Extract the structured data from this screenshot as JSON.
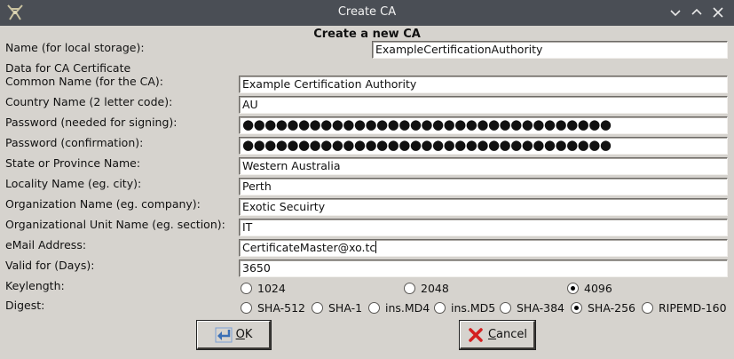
{
  "window": {
    "title": "Create CA"
  },
  "form": {
    "heading": "Create a new CA",
    "name_label": "Name (for local storage):",
    "name_value": "ExampleCertificationAuthority",
    "section_label": "Data for CA Certificate",
    "fields": [
      {
        "label": "Common Name (for the CA):",
        "value": "Example Certification Authority"
      },
      {
        "label": "Country Name (2 letter code):",
        "value": "AU"
      },
      {
        "label": "Password (needed for signing):",
        "value": "●●●●●●●●●●●●●●●●●●●●●●●●●●●●●●●●●"
      },
      {
        "label": "Password (confirmation):",
        "value": "●●●●●●●●●●●●●●●●●●●●●●●●●●●●●●●●●"
      },
      {
        "label": "State or Province Name:",
        "value": "Western Australia"
      },
      {
        "label": "Locality Name (eg. city):",
        "value": "Perth"
      },
      {
        "label": "Organization Name (eg. company):",
        "value": "Exotic Secuirty"
      },
      {
        "label": "Organizational Unit Name (eg. section):",
        "value": "IT"
      },
      {
        "label": "eMail Address:",
        "value": "CertificateMaster@xo.tc"
      },
      {
        "label": "Valid for (Days):",
        "value": "3650"
      }
    ],
    "keylength": {
      "label": "Keylength:",
      "options": [
        "1024",
        "2048",
        "4096"
      ],
      "selected": "4096"
    },
    "digest": {
      "label": "Digest:",
      "options": [
        "SHA-512",
        "SHA-1",
        "ins.MD4",
        "ins.MD5",
        "SHA-384",
        "SHA-256",
        "RIPEMD-160"
      ],
      "selected": "SHA-256"
    }
  },
  "buttons": {
    "ok_mnemonic": "O",
    "ok_rest": "K",
    "cancel_mnemonic": "C",
    "cancel_rest": "ancel"
  },
  "icons": {
    "app": "kali-dragon-icon",
    "minimize": "chevron-down-icon",
    "maximize": "chevron-up-icon",
    "close": "close-icon",
    "ok": "return-arrow-icon",
    "cancel": "red-x-icon"
  },
  "colors": {
    "titlebar": "#4a4e55",
    "dialog_bg": "#d6d3ce",
    "field_bg": "#ffffff",
    "cancel_icon": "#d42020",
    "ok_icon": "#3a6fb5"
  }
}
